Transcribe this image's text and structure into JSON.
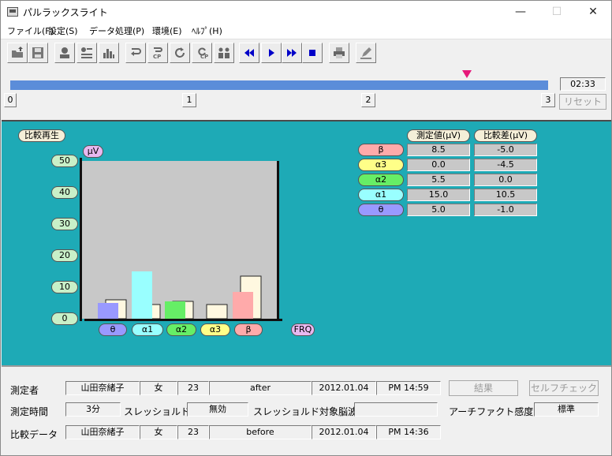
{
  "window": {
    "title": "パルラックスライト"
  },
  "menu": [
    "ファイル(F)",
    "設定(S)",
    "データ処理(P)",
    "環境(E)",
    "ﾍﾙﾌﾟ(H)"
  ],
  "toolbar": {
    "icons": [
      "open-folder-icon",
      "save-icon",
      "person-icon",
      "list-icon",
      "bar-chart-icon",
      "return-icon",
      "cp-return-icon",
      "refresh-icon",
      "cp-refresh-icon",
      "group-icon",
      "rewind-icon",
      "play-icon",
      "fast-forward-icon",
      "stop-icon",
      "printer-icon",
      "edit-icon"
    ],
    "accent": "#0000c8"
  },
  "timeline": {
    "time": "02:33",
    "progress": 0.85,
    "ticks": [
      "0",
      "1",
      "2",
      "3"
    ],
    "reset_label": "リセット",
    "bar_color": "#5b8dd9",
    "marker_color": "#e6197a"
  },
  "panel": {
    "title": "比較再生",
    "unit": "μV",
    "xlabel": "FRQ",
    "background": "#1eaab6"
  },
  "chart_data": {
    "type": "bar",
    "categories": [
      "θ",
      "α1",
      "α2",
      "α3",
      "β"
    ],
    "category_colors": [
      "#9999ff",
      "#99ffff",
      "#66ee66",
      "#ffff88",
      "#ffaaaa"
    ],
    "series": [
      {
        "values": [
          5.0,
          15.0,
          5.5,
          0.0,
          8.5
        ],
        "colors": [
          "#9999ff",
          "#99ffff",
          "#66ee66",
          "#ffff99",
          "#ffaaaa"
        ]
      },
      {
        "values": [
          6.0,
          4.5,
          5.5,
          4.5,
          13.5
        ],
        "colors": [
          "#fff8e0",
          "#fff8e0",
          "#fff8e0",
          "#fff8e0",
          "#fff8e0"
        ]
      }
    ],
    "y_ticks": [
      "50",
      "40",
      "30",
      "20",
      "10",
      "0"
    ],
    "ylim": [
      0,
      50
    ]
  },
  "table": {
    "headers": [
      "測定値(μV)",
      "比較差(μV)"
    ],
    "rows": [
      {
        "label": "β",
        "color": "#ffaaaa",
        "measured": "8.5",
        "diff": "-5.0"
      },
      {
        "label": "α3",
        "color": "#ffff88",
        "measured": "0.0",
        "diff": "-4.5"
      },
      {
        "label": "α2",
        "color": "#66ee66",
        "measured": "5.5",
        "diff": "0.0"
      },
      {
        "label": "α1",
        "color": "#99ffff",
        "measured": "15.0",
        "diff": "10.5"
      },
      {
        "label": "θ",
        "color": "#9999ff",
        "measured": "5.0",
        "diff": "-1.0"
      }
    ]
  },
  "info": {
    "measurer_label": "測定者",
    "measurer": {
      "name": "山田奈緒子",
      "sex": "女",
      "age": "23",
      "tag": "after",
      "date": "2012.01.04",
      "time": "PM 14:59"
    },
    "duration_label": "測定時間",
    "duration": "3分",
    "threshold_label": "スレッショルド",
    "threshold": "無効",
    "target_label": "スレッショルド対象脳波",
    "target": "",
    "artifact_label": "アーチファクト感度",
    "artifact": "標準",
    "compare_label": "比較データ",
    "compare": {
      "name": "山田奈緒子",
      "sex": "女",
      "age": "23",
      "tag": "before",
      "date": "2012.01.04",
      "time": "PM 14:36"
    },
    "result_label": "結果",
    "selfcheck_label": "セルフチェック"
  }
}
